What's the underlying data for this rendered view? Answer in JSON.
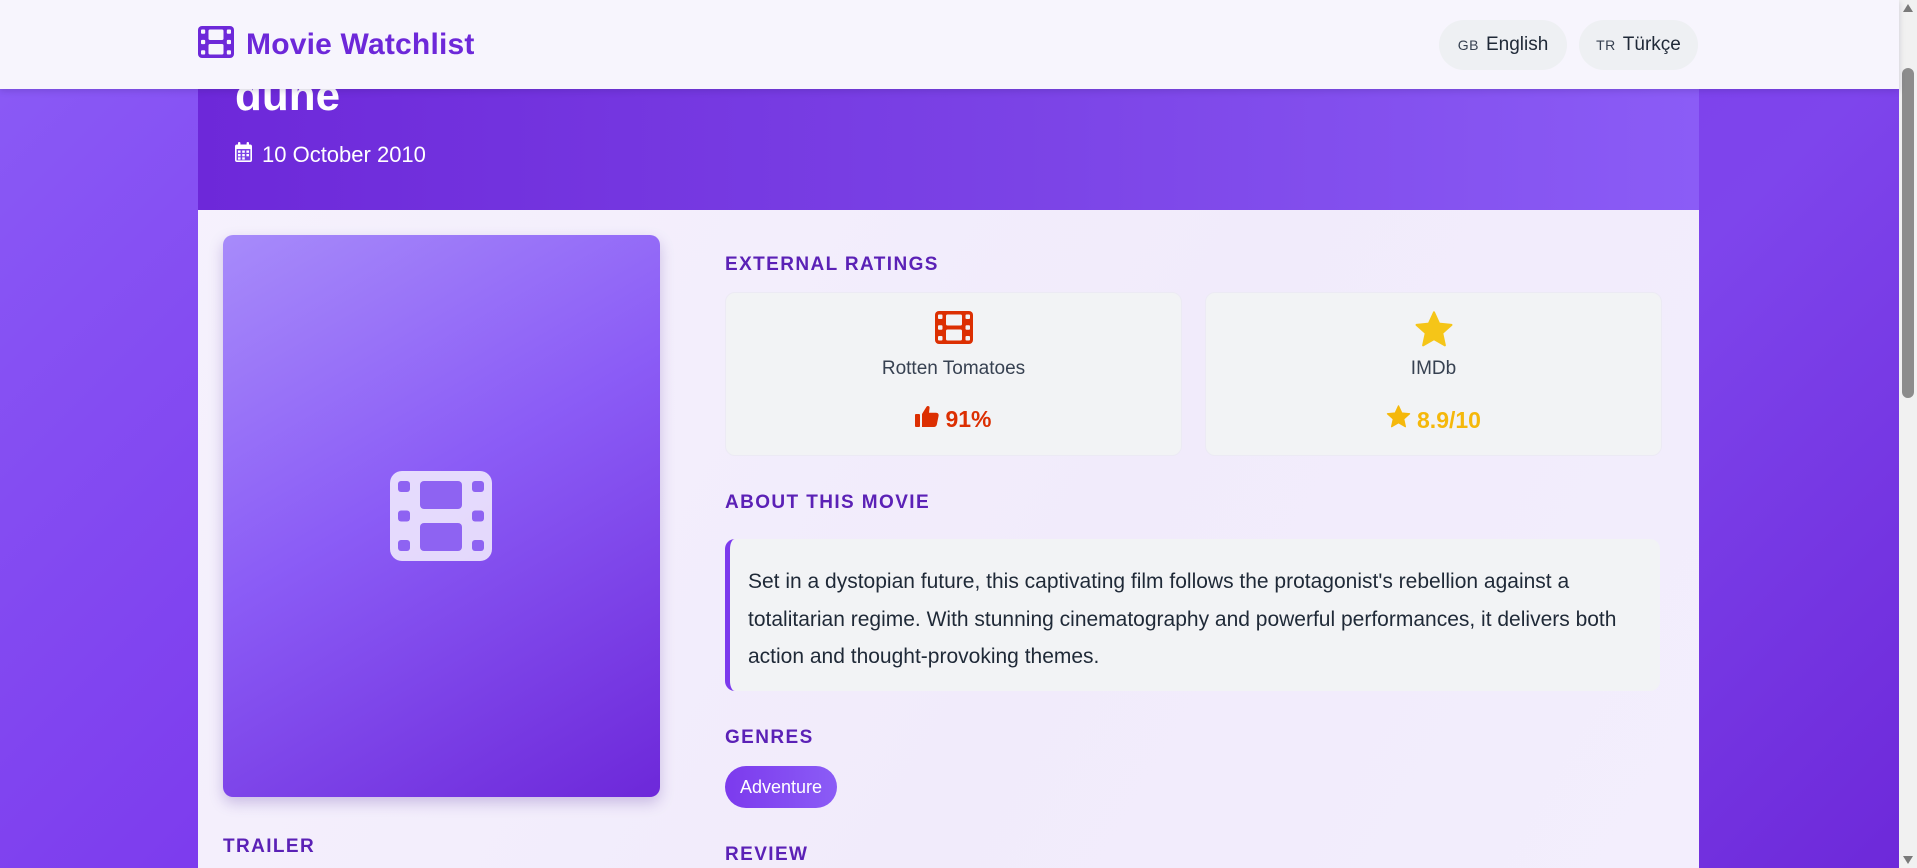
{
  "navbar": {
    "brand_title": "Movie Watchlist",
    "languages": [
      {
        "code": "GB",
        "label": "English"
      },
      {
        "code": "TR",
        "label": "Türkçe"
      }
    ]
  },
  "movie": {
    "title": "dune",
    "release_date": "10 October 2010",
    "external_ratings_heading": "EXTERNAL RATINGS",
    "ratings": [
      {
        "source": "Rotten Tomatoes",
        "value": "91%",
        "icon": "film-icon",
        "value_icon": "thumbs-up-icon",
        "color": "#dc2f02"
      },
      {
        "source": "IMDb",
        "value": "8.9/10",
        "icon": "star-icon",
        "value_icon": "star-icon",
        "color": "#f5b80b"
      }
    ],
    "about_heading": "ABOUT THIS MOVIE",
    "about_text": "Set in a dystopian future, this captivating film follows the protagonist's rebellion against a totalitarian regime. With stunning cinematography and powerful performances, it delivers both action and thought-provoking themes.",
    "genres_heading": "GENRES",
    "genres": [
      "Adventure"
    ],
    "review_heading": "REVIEW",
    "trailer_heading": "TRAILER"
  },
  "colors": {
    "accent": "#6d28d9",
    "accent_light": "#8b5cf6",
    "rotten_tomatoes": "#dc2f02",
    "imdb": "#f5b80b"
  }
}
